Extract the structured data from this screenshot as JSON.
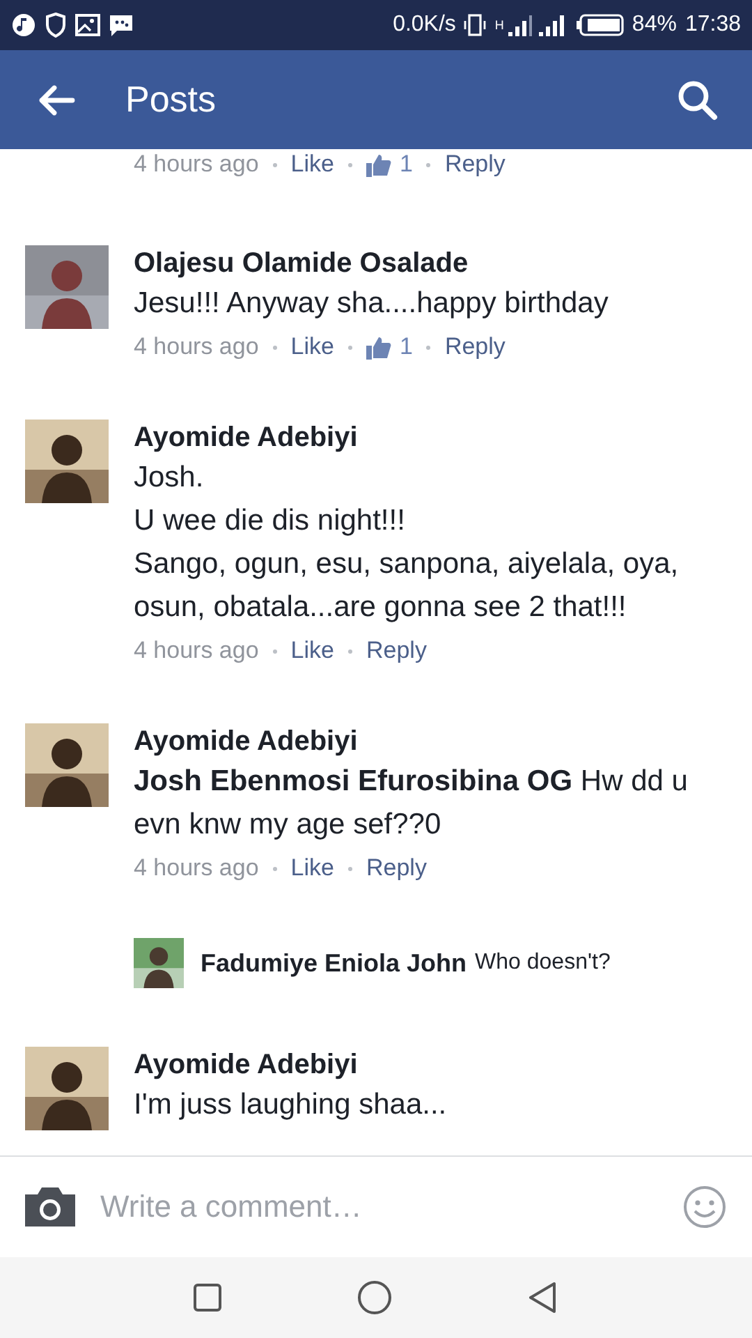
{
  "status_bar": {
    "speed": "0.0K/s",
    "network": "H",
    "battery": "84%",
    "time": "17:38"
  },
  "header": {
    "title": "Posts"
  },
  "comments": [
    {
      "kind": "meta",
      "time": "4 hours ago",
      "like": "Like",
      "likes": "1",
      "reply": "Reply"
    },
    {
      "kind": "comment",
      "name": "Olajesu Olamide Osalade",
      "lines": [
        "Jesu!!! Anyway sha....happy birthday"
      ],
      "time": "4 hours ago",
      "like": "Like",
      "likes": "1",
      "reply": "Reply"
    },
    {
      "kind": "comment",
      "name": "Ayomide Adebiyi",
      "lines": [
        "Josh.",
        "U wee die dis night!!!",
        "Sango, ogun, esu, sanpona, aiyelala, oya, osun, obatala...are gonna see 2 that!!!"
      ],
      "time": "4 hours ago",
      "like": "Like",
      "reply": "Reply"
    },
    {
      "kind": "comment",
      "name": "Ayomide Adebiyi",
      "lines": [
        "**Josh Ebenmosi Efurosibina OG** Hw dd u evn knw my age sef??0"
      ],
      "time": "4 hours ago",
      "like": "Like",
      "reply": "Reply"
    },
    {
      "kind": "reply",
      "name": "Fadumiye Eniola John",
      "text": "Who doesn't?"
    },
    {
      "kind": "comment",
      "name": "Ayomide Adebiyi",
      "lines": [
        "I'm juss laughing shaa..."
      ]
    }
  ],
  "composer": {
    "placeholder": "Write a comment…"
  }
}
